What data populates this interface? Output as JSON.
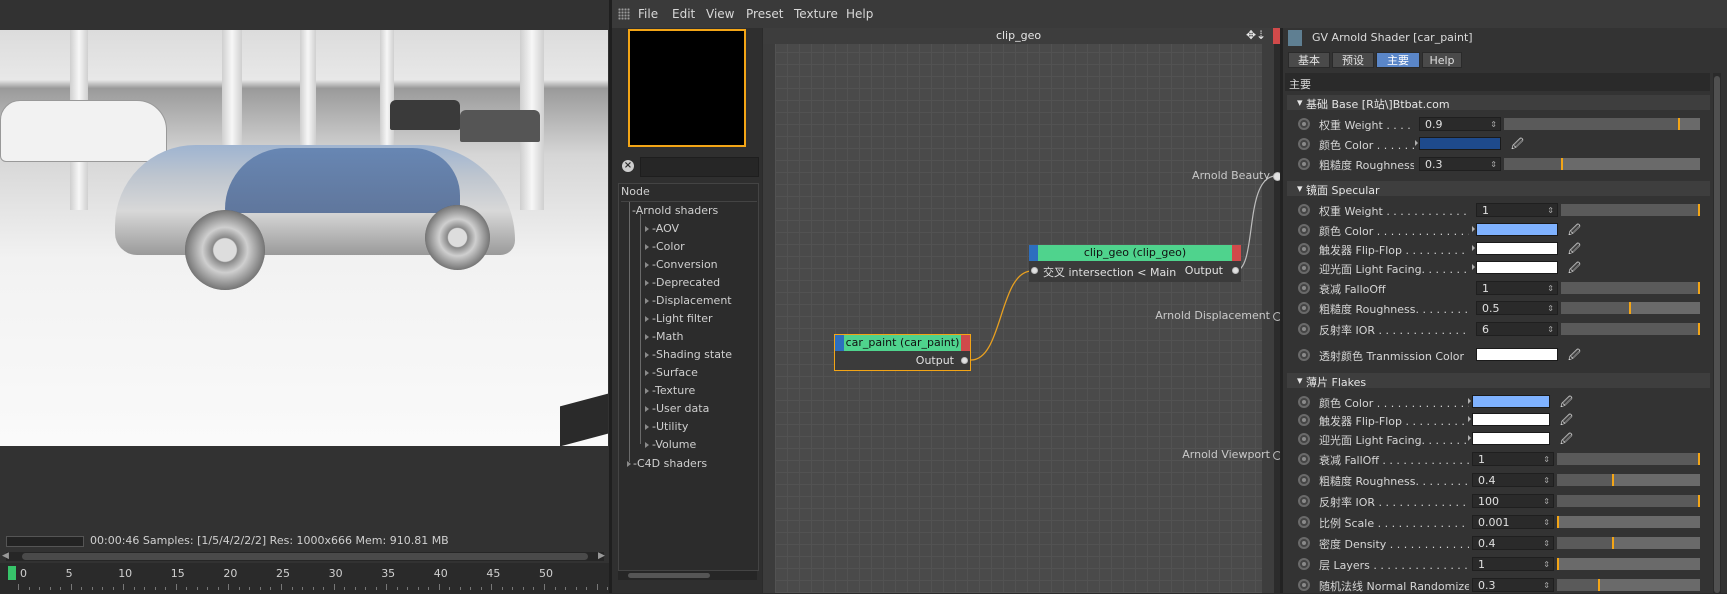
{
  "menubar": {
    "items": [
      "File",
      "Edit",
      "View",
      "Preset",
      "Texture",
      "Help"
    ]
  },
  "viewport": {
    "status_text": "00:00:46  Samples: [1/5/4/2/2/2]  Res: 1000x666  Mem: 910.81 MB",
    "timeline_labels": [
      "0",
      "5",
      "10",
      "15",
      "20",
      "25",
      "30",
      "35",
      "40",
      "45",
      "50"
    ]
  },
  "node_tree": {
    "header": "Node",
    "root": "Arnold shaders",
    "children": [
      "AOV",
      "Color",
      "Conversion",
      "Deprecated",
      "Displacement",
      "Light filter",
      "Math",
      "Shading state",
      "Surface",
      "Texture",
      "User data",
      "Utility",
      "Volume"
    ],
    "root2": "C4D shaders"
  },
  "graph": {
    "title": "clip_geo",
    "ports": {
      "arnold_beauty": "Arnold Beauty",
      "arnold_displacement": "Arnold Displacement",
      "arnold_viewport": "Arnold Viewport"
    },
    "nodes": {
      "clip_geo": {
        "title": "clip_geo (clip_geo)",
        "input": "交叉 intersection < Main",
        "output": "Output"
      },
      "car_paint": {
        "title": "car_paint (car_paint)",
        "output": "Output"
      }
    }
  },
  "attributes": {
    "title": "GV Arnold Shader [car_paint]",
    "tabs": [
      "基本",
      "预设",
      "主要",
      "Help"
    ],
    "active_tab": "主要",
    "section": "主要",
    "groups": {
      "base": {
        "label": "基础 Base [R站\\]Btbat.com",
        "params": [
          {
            "label": "权重 Weight . . . . . .",
            "value": "0.9",
            "slider": 0.9
          },
          {
            "label": "颜色 Color . . . . . .",
            "swatch": "#1e4a8c"
          },
          {
            "label": "粗糙度 Roughness",
            "value": "0.3",
            "slider": 0.3
          }
        ]
      },
      "specular": {
        "label": "镜面 Specular",
        "params": [
          {
            "label": "权重 Weight . . . . . . . . . . . . . . . .",
            "value": "1",
            "slider": 1.0
          },
          {
            "label": "颜色 Color . . . . . . . . . . . . . . . . .",
            "swatch": "#7fb2ff"
          },
          {
            "label": "触发器 Flip-Flop . . . . . . . . . . . . .",
            "swatch": "#ffffff"
          },
          {
            "label": "迎光面 Light Facing. . . . . . . . . . .",
            "swatch": "#ffffff"
          },
          {
            "label": "衰减 FalloOff",
            "value": "1",
            "slider": 1.0
          },
          {
            "label": "粗糙度 Roughness. . . . . . . . . . . . .",
            "value": "0.5",
            "slider": 0.5
          },
          {
            "label": "反射率 IOR . . . . . . . . . . . . . . . .",
            "value": "6",
            "slider": 1.0
          }
        ]
      },
      "transmission": {
        "label": "透射颜色 Tranmission Color",
        "swatch": "#ffffff"
      },
      "flakes": {
        "label": "薄片 Flakes",
        "params": [
          {
            "label": "颜色 Color . . . . . . . . . . . . . . . .",
            "swatch": "#7fb2ff"
          },
          {
            "label": "触发器 Flip-Flop . . . . . . . . . . . .",
            "swatch": "#ffffff"
          },
          {
            "label": "迎光面 Light Facing. . . . . . . . . .",
            "swatch": "#ffffff"
          },
          {
            "label": "衰减 FallOff . . . . . . . . . . . . . .",
            "value": "1",
            "slider": 1.0
          },
          {
            "label": "粗糙度 Roughness. . . . . . . . . . . .",
            "value": "0.4",
            "slider": 0.4
          },
          {
            "label": "反射率 IOR . . . . . . . . . . . . . . .",
            "value": "100",
            "slider": 1.0
          },
          {
            "label": "比例 Scale . . . . . . . . . . . . . . . .",
            "value": "0.001",
            "slider": 0.0
          },
          {
            "label": "密度 Density . . . . . . . . . . . . . . .",
            "value": "0.4",
            "slider": 0.4
          },
          {
            "label": "层 Layers . . . . . . . . . . . . . . . . .",
            "value": "1",
            "slider": 0.0
          },
          {
            "label": "随机法线 Normal Randomize",
            "value": "0.3",
            "slider": 0.3
          }
        ]
      }
    }
  },
  "colors": {
    "accent": "#f3a516",
    "node_header": "#4fd38d",
    "active_tab": "#5a86c8"
  }
}
